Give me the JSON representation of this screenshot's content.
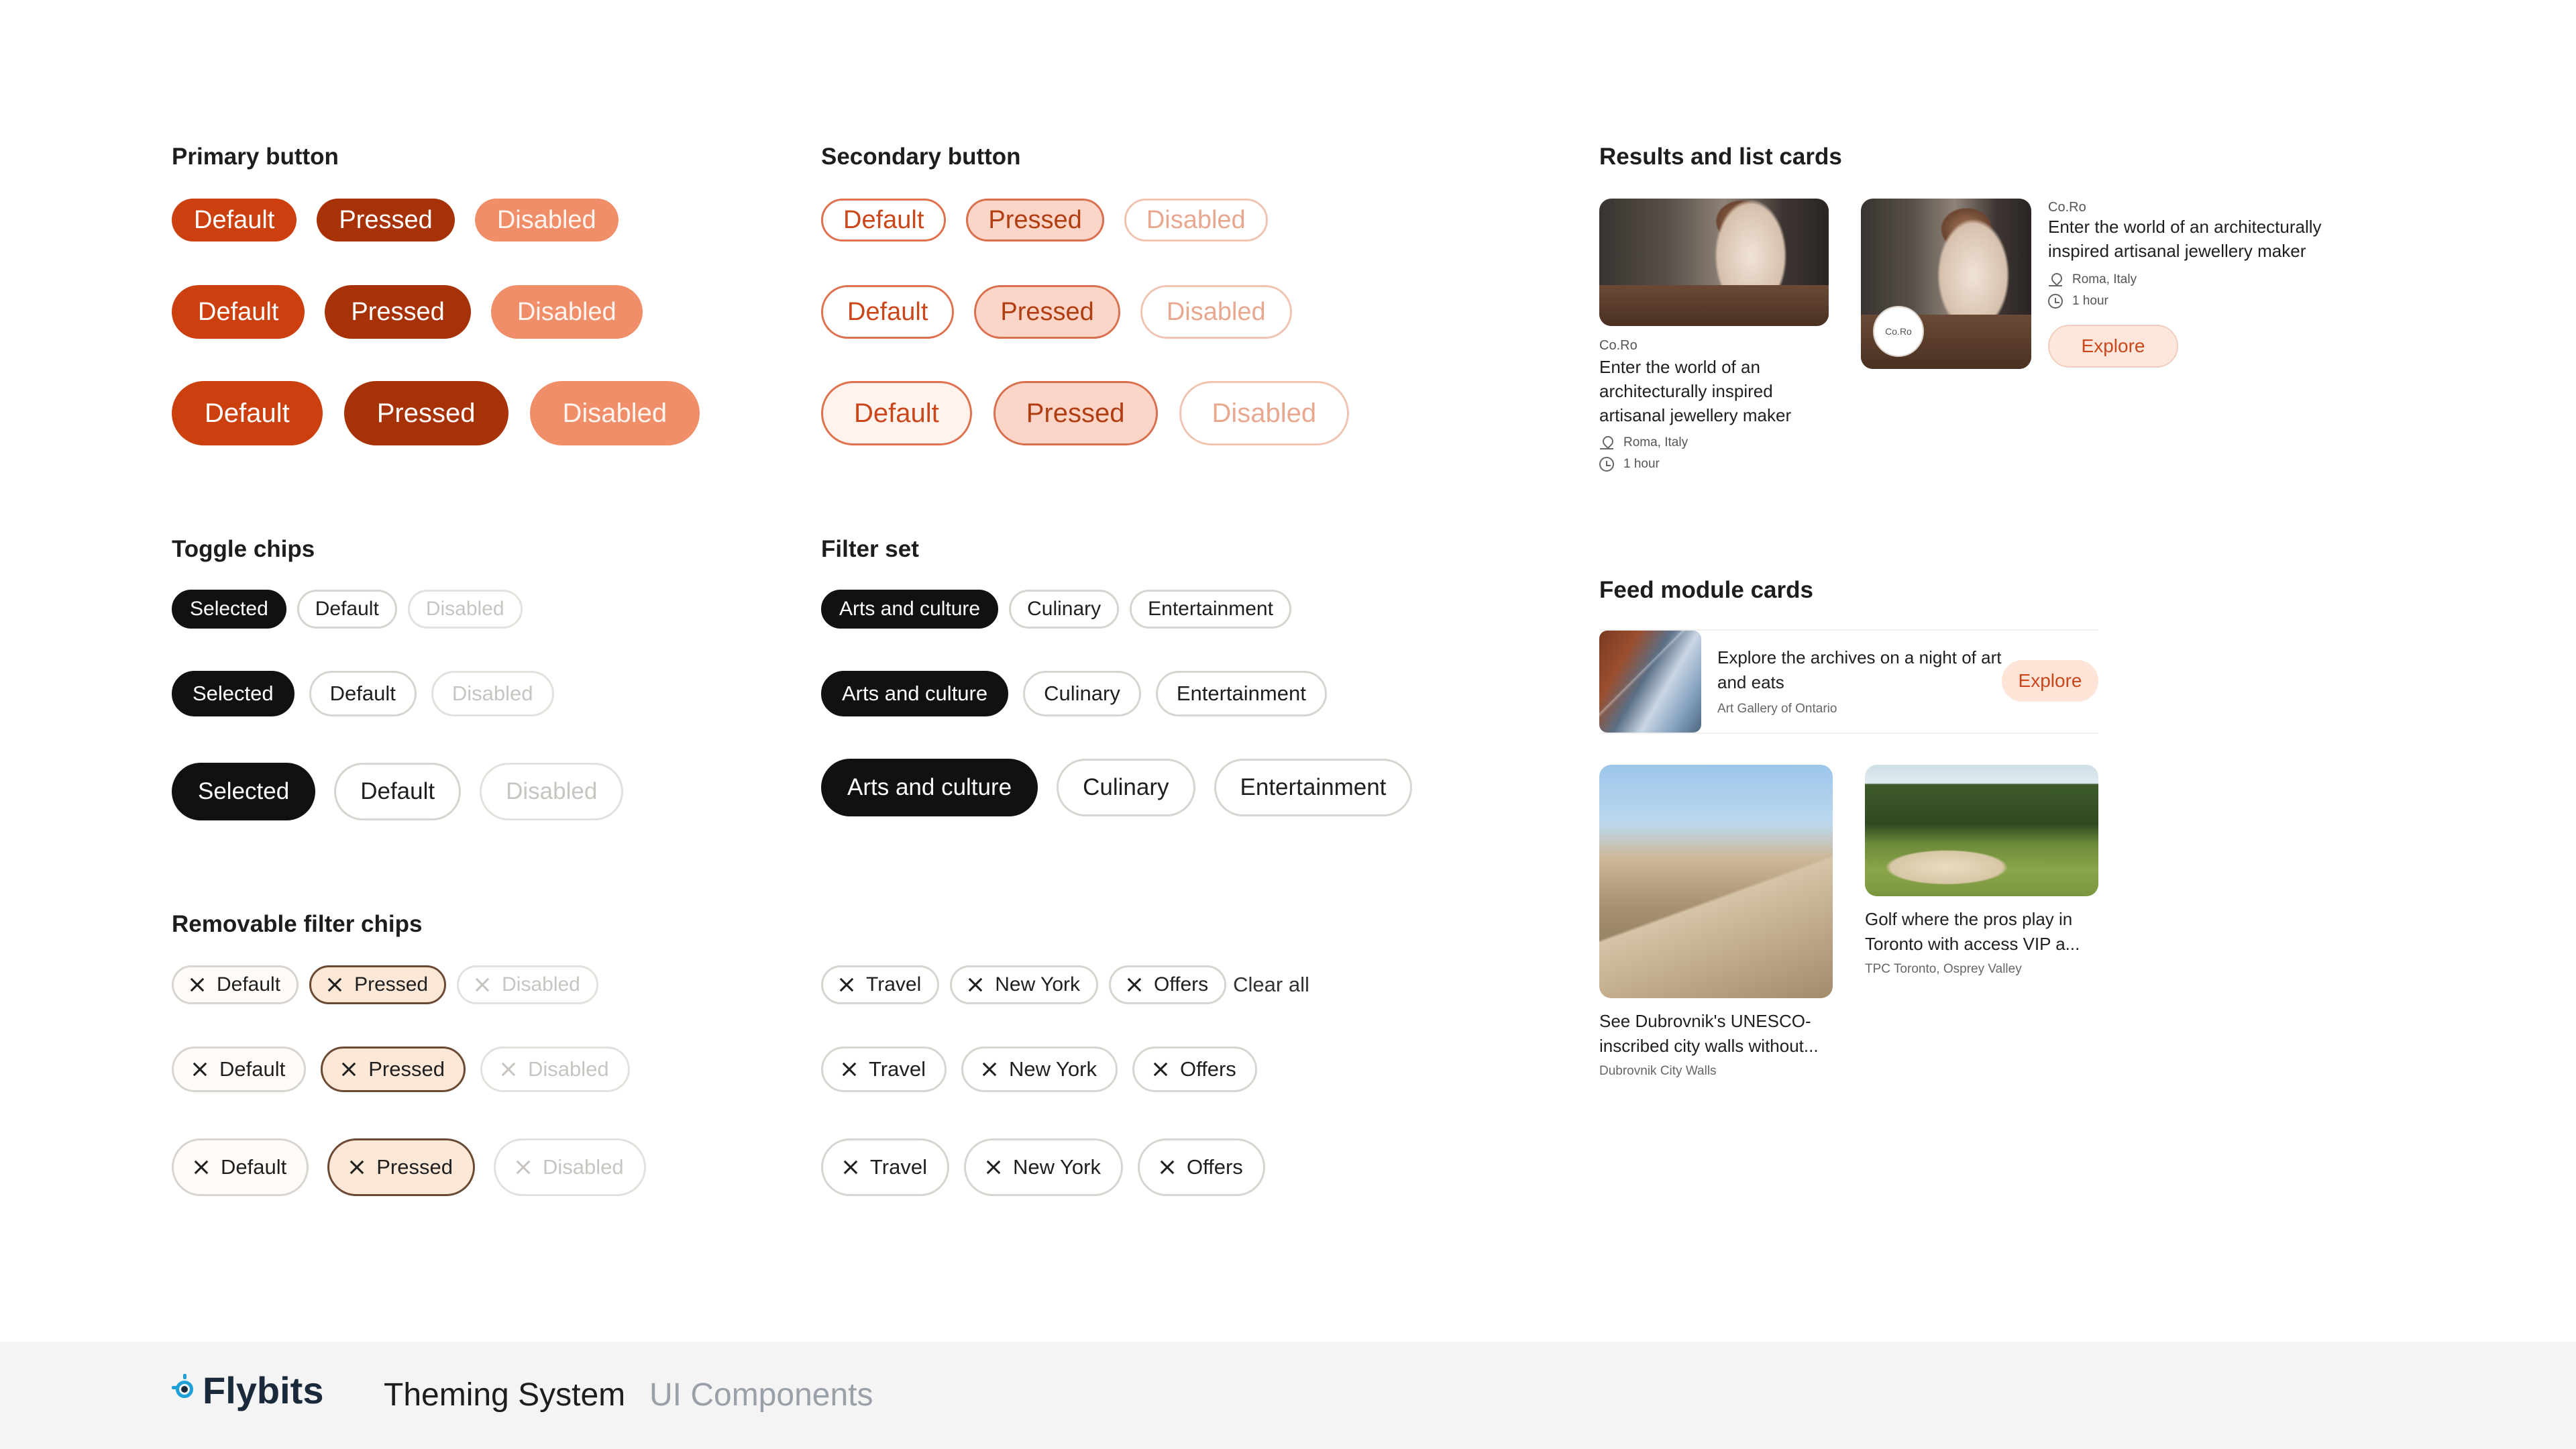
{
  "sections": {
    "primary": "Primary button",
    "secondary": "Secondary button",
    "results": "Results and list cards",
    "toggle": "Toggle chips",
    "filter": "Filter set",
    "feed": "Feed module cards",
    "removable": "Removable filter chips"
  },
  "buttons": {
    "default": "Default",
    "pressed": "Pressed",
    "disabled": "Disabled"
  },
  "toggle": {
    "selected": "Selected",
    "default": "Default",
    "disabled": "Disabled"
  },
  "filters": [
    "Arts and culture",
    "Culinary",
    "Entertainment"
  ],
  "removable": {
    "default": "Default",
    "pressed": "Pressed",
    "disabled": "Disabled",
    "tags": [
      "Travel",
      "New York",
      "Offers"
    ],
    "clear_all": "Clear all"
  },
  "results_card": {
    "brand": "Co.Ro",
    "title": "Enter the world of an architecturally inspired artisanal jewellery maker",
    "location": "Roma, Italy",
    "duration": "1 hour",
    "cta": "Explore",
    "logo_text": "Co.Ro"
  },
  "feed": {
    "row": {
      "title": "Explore the archives on a night of art and eats",
      "sub": "Art Gallery of Ontario",
      "cta": "Explore"
    },
    "tile1": {
      "title": "See Dubrovnik's UNESCO-inscribed city walls without...",
      "sub": "Dubrovnik City Walls"
    },
    "tile2": {
      "title": "Golf where the pros play in Toronto with access VIP a...",
      "sub": "TPC Toronto, Osprey Valley"
    }
  },
  "footer": {
    "brand": "Flybits",
    "title": "Theming System",
    "subtitle": "UI Components"
  },
  "colors": {
    "primary": "#cc4010",
    "primary_pressed": "#a83208",
    "primary_disabled": "#f08e6a",
    "brand_blue": "#1da1d8"
  }
}
